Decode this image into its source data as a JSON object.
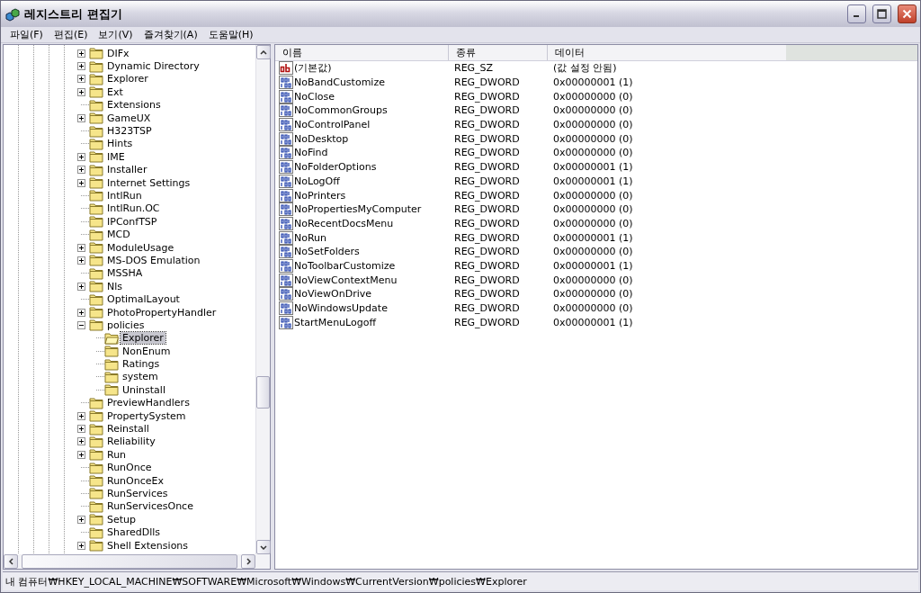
{
  "window": {
    "title": "레지스트리 편집기"
  },
  "menu": [
    {
      "label": "파일(F)"
    },
    {
      "label": "편집(E)"
    },
    {
      "label": "보기(V)"
    },
    {
      "label": "즐겨찾기(A)"
    },
    {
      "label": "도움말(H)"
    }
  ],
  "tree": [
    {
      "label": "DIFx",
      "kind": "collapsed",
      "selected": false
    },
    {
      "label": "Dynamic Directory",
      "kind": "collapsed",
      "selected": false
    },
    {
      "label": "Explorer",
      "kind": "collapsed",
      "selected": false
    },
    {
      "label": "Ext",
      "kind": "collapsed",
      "selected": false
    },
    {
      "label": "Extensions",
      "kind": "leaf",
      "selected": false
    },
    {
      "label": "GameUX",
      "kind": "collapsed",
      "selected": false
    },
    {
      "label": "H323TSP",
      "kind": "leaf",
      "selected": false
    },
    {
      "label": "Hints",
      "kind": "leaf",
      "selected": false
    },
    {
      "label": "IME",
      "kind": "collapsed",
      "selected": false
    },
    {
      "label": "Installer",
      "kind": "collapsed",
      "selected": false
    },
    {
      "label": "Internet Settings",
      "kind": "collapsed",
      "selected": false
    },
    {
      "label": "IntlRun",
      "kind": "leaf",
      "selected": false
    },
    {
      "label": "IntlRun.OC",
      "kind": "leaf",
      "selected": false
    },
    {
      "label": "IPConfTSP",
      "kind": "leaf",
      "selected": false
    },
    {
      "label": "MCD",
      "kind": "leaf",
      "selected": false
    },
    {
      "label": "ModuleUsage",
      "kind": "collapsed",
      "selected": false
    },
    {
      "label": "MS-DOS Emulation",
      "kind": "collapsed",
      "selected": false
    },
    {
      "label": "MSSHA",
      "kind": "leaf",
      "selected": false
    },
    {
      "label": "Nls",
      "kind": "collapsed",
      "selected": false
    },
    {
      "label": "OptimalLayout",
      "kind": "leaf",
      "selected": false
    },
    {
      "label": "PhotoPropertyHandler",
      "kind": "collapsed",
      "selected": false
    },
    {
      "label": "policies",
      "kind": "expanded",
      "selected": false,
      "children": [
        {
          "label": "Explorer",
          "kind": "leaf",
          "selected": true
        },
        {
          "label": "NonEnum",
          "kind": "leaf",
          "selected": false
        },
        {
          "label": "Ratings",
          "kind": "leaf",
          "selected": false
        },
        {
          "label": "system",
          "kind": "leaf",
          "selected": false
        },
        {
          "label": "Uninstall",
          "kind": "leaf",
          "selected": false
        }
      ]
    },
    {
      "label": "PreviewHandlers",
      "kind": "leaf",
      "selected": false
    },
    {
      "label": "PropertySystem",
      "kind": "collapsed",
      "selected": false
    },
    {
      "label": "Reinstall",
      "kind": "collapsed",
      "selected": false
    },
    {
      "label": "Reliability",
      "kind": "collapsed",
      "selected": false
    },
    {
      "label": "Run",
      "kind": "collapsed",
      "selected": false
    },
    {
      "label": "RunOnce",
      "kind": "leaf",
      "selected": false
    },
    {
      "label": "RunOnceEx",
      "kind": "leaf",
      "selected": false
    },
    {
      "label": "RunServices",
      "kind": "leaf",
      "selected": false
    },
    {
      "label": "RunServicesOnce",
      "kind": "leaf",
      "selected": false
    },
    {
      "label": "Setup",
      "kind": "collapsed",
      "selected": false
    },
    {
      "label": "SharedDlls",
      "kind": "leaf",
      "selected": false
    },
    {
      "label": "Shell Extensions",
      "kind": "collapsed",
      "selected": false
    }
  ],
  "table": {
    "columns": [
      "이름",
      "종류",
      "데이터"
    ],
    "rows": [
      {
        "kind": "string",
        "name": "(기본값)",
        "type": "REG_SZ",
        "data": "(값 설정 안됨)"
      },
      {
        "kind": "dword",
        "name": "NoBandCustomize",
        "type": "REG_DWORD",
        "data": "0x00000001 (1)"
      },
      {
        "kind": "dword",
        "name": "NoClose",
        "type": "REG_DWORD",
        "data": "0x00000000 (0)"
      },
      {
        "kind": "dword",
        "name": "NoCommonGroups",
        "type": "REG_DWORD",
        "data": "0x00000000 (0)"
      },
      {
        "kind": "dword",
        "name": "NoControlPanel",
        "type": "REG_DWORD",
        "data": "0x00000000 (0)"
      },
      {
        "kind": "dword",
        "name": "NoDesktop",
        "type": "REG_DWORD",
        "data": "0x00000000 (0)"
      },
      {
        "kind": "dword",
        "name": "NoFind",
        "type": "REG_DWORD",
        "data": "0x00000000 (0)"
      },
      {
        "kind": "dword",
        "name": "NoFolderOptions",
        "type": "REG_DWORD",
        "data": "0x00000001 (1)"
      },
      {
        "kind": "dword",
        "name": "NoLogOff",
        "type": "REG_DWORD",
        "data": "0x00000001 (1)"
      },
      {
        "kind": "dword",
        "name": "NoPrinters",
        "type": "REG_DWORD",
        "data": "0x00000000 (0)"
      },
      {
        "kind": "dword",
        "name": "NoPropertiesMyComputer",
        "type": "REG_DWORD",
        "data": "0x00000000 (0)"
      },
      {
        "kind": "dword",
        "name": "NoRecentDocsMenu",
        "type": "REG_DWORD",
        "data": "0x00000000 (0)"
      },
      {
        "kind": "dword",
        "name": "NoRun",
        "type": "REG_DWORD",
        "data": "0x00000001 (1)"
      },
      {
        "kind": "dword",
        "name": "NoSetFolders",
        "type": "REG_DWORD",
        "data": "0x00000000 (0)"
      },
      {
        "kind": "dword",
        "name": "NoToolbarCustomize",
        "type": "REG_DWORD",
        "data": "0x00000001 (1)"
      },
      {
        "kind": "dword",
        "name": "NoViewContextMenu",
        "type": "REG_DWORD",
        "data": "0x00000000 (0)"
      },
      {
        "kind": "dword",
        "name": "NoViewOnDrive",
        "type": "REG_DWORD",
        "data": "0x00000000 (0)"
      },
      {
        "kind": "dword",
        "name": "NoWindowsUpdate",
        "type": "REG_DWORD",
        "data": "0x00000000 (0)"
      },
      {
        "kind": "dword",
        "name": "StartMenuLogoff",
        "type": "REG_DWORD",
        "data": "0x00000001 (1)"
      }
    ]
  },
  "status_bar": {
    "path": "내 컴퓨터₩HKEY_LOCAL_MACHINE₩SOFTWARE₩Microsoft₩Windows₩CurrentVersion₩policies₩Explorer"
  }
}
